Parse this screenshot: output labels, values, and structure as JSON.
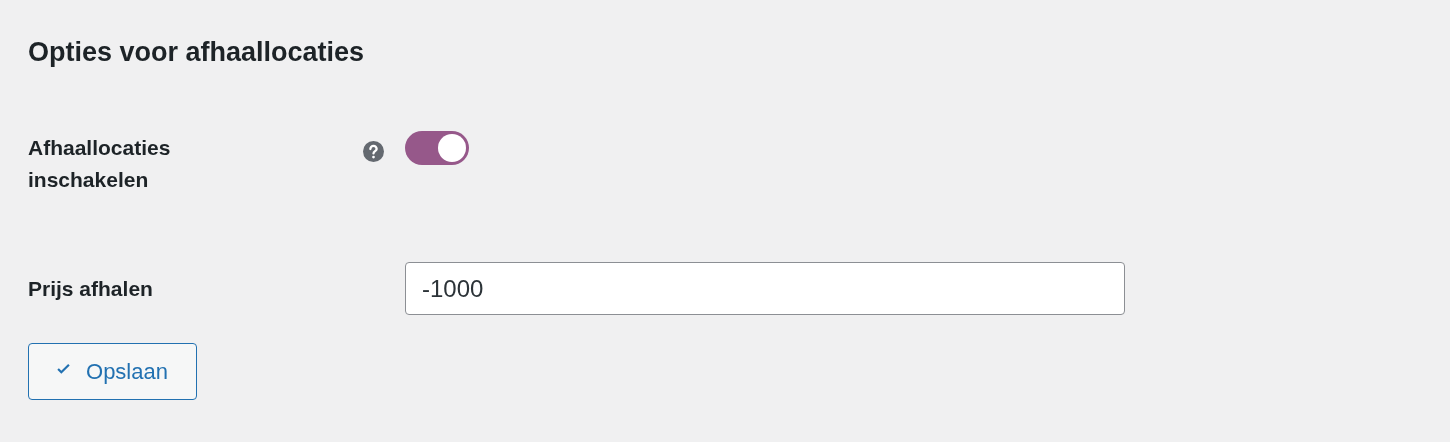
{
  "title": "Opties voor afhaallocaties",
  "settings": [
    {
      "kind": "toggle",
      "label": "Afhaallocaties inschakelen",
      "help": true,
      "on": true
    },
    {
      "kind": "text",
      "label": "Prijs afhalen",
      "help": false,
      "value": "-1000"
    }
  ],
  "save_button": {
    "label": "Opslaan"
  }
}
